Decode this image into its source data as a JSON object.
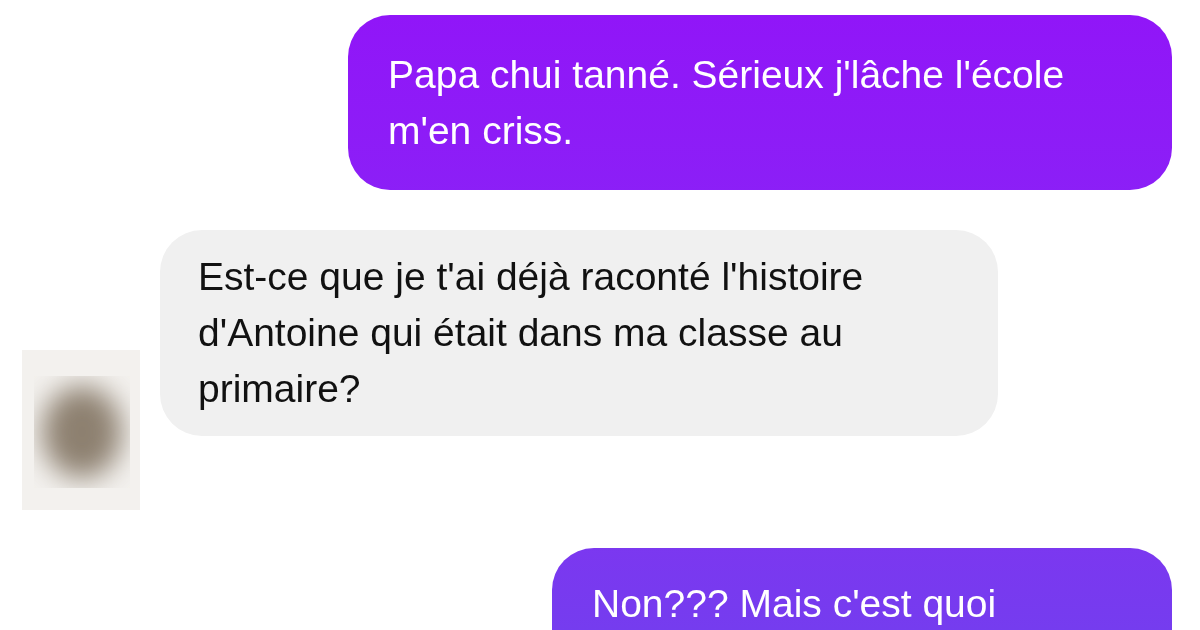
{
  "messages": [
    {
      "kind": "sent",
      "text": "Papa chui tanné. Sérieux j'lâche l'école m'en criss."
    },
    {
      "kind": "received",
      "text": "Est-ce que je t'ai déjà raconté l'histoire d'Antoine qui était dans ma classe au primaire?"
    },
    {
      "kind": "sent",
      "text": "Non??? Mais c'est quoi"
    }
  ]
}
